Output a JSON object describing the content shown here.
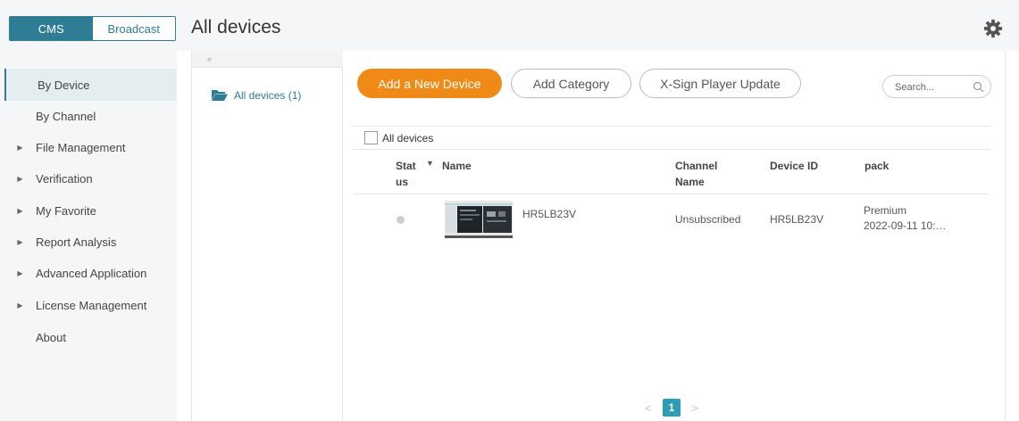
{
  "header": {
    "tabs": [
      {
        "label": "CMS",
        "active": true
      },
      {
        "label": "Broadcast",
        "active": false
      }
    ],
    "title": "All devices",
    "settings_icon": "gear-icon"
  },
  "sidebar": {
    "items": [
      {
        "label": "By Device",
        "active": true,
        "expandable": false
      },
      {
        "label": "By Channel",
        "expandable": false
      },
      {
        "label": "File Management",
        "expandable": true
      },
      {
        "label": "Verification",
        "expandable": true
      },
      {
        "label": "My Favorite",
        "expandable": true
      },
      {
        "label": "Report Analysis",
        "expandable": true
      },
      {
        "label": "Advanced Application",
        "expandable": true
      },
      {
        "label": "License Management",
        "expandable": true
      },
      {
        "label": "About",
        "expandable": false
      }
    ]
  },
  "tree": {
    "collapse_glyph": "«",
    "root_label": "All devices (1)",
    "root_icon": "folder-open-icon"
  },
  "toolbar": {
    "add_device": "Add a New Device",
    "add_category": "Add Category",
    "player_update": "X-Sign Player Update",
    "search_placeholder": "Search...",
    "search_icon": "search-icon"
  },
  "category": {
    "label": "All devices"
  },
  "table": {
    "columns": {
      "status_1": "Stat",
      "status_2": "us",
      "name": "Name",
      "channel_1": "Channel",
      "channel_2": "Name",
      "device_id": "Device ID",
      "pack": "pack"
    },
    "rows": [
      {
        "status": "offline",
        "name": "HR5LB23V",
        "channel": "Unsubscribed",
        "device_id": "HR5LB23V",
        "pack_1": "Premium",
        "pack_2": "2022-09-11 10:…"
      }
    ]
  },
  "pagination": {
    "prev": "<",
    "current": "1",
    "next": ">"
  },
  "colors": {
    "accent": "#2f7c95",
    "primary_button": "#f08a17",
    "page_active": "#2f9bb4"
  }
}
